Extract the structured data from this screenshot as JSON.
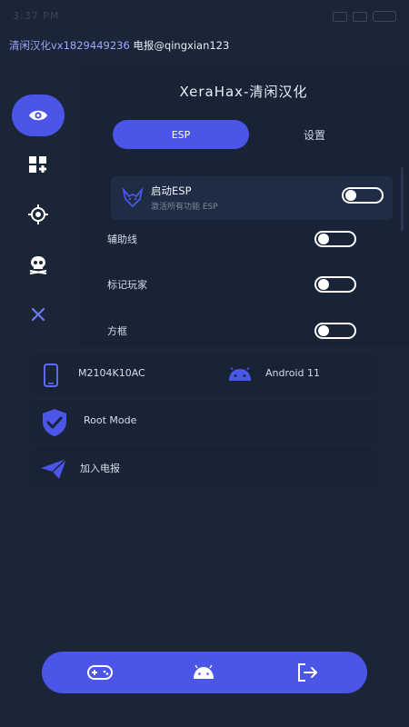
{
  "status_bar": {
    "time": "3:37 PM"
  },
  "marquee": {
    "prefix": "清闲汉化vx1829449236",
    "suffix": " 电报@qingxian123"
  },
  "panel": {
    "title": "XeraHax-清闲汉化",
    "tabs": [
      {
        "label": "ESP",
        "active": true
      },
      {
        "label": "设置",
        "active": false
      }
    ],
    "esp_toggle": {
      "title": "启动ESP",
      "subtitle": "激活所有功能 ESP",
      "enabled": false
    },
    "options": [
      {
        "label": "辅助线",
        "enabled": false
      },
      {
        "label": "标记玩家",
        "enabled": false
      },
      {
        "label": "方框",
        "enabled": false
      }
    ]
  },
  "device": {
    "model": "M2104K10AC",
    "os": "Android 11"
  },
  "root": {
    "label": "Root Mode"
  },
  "telegram": {
    "label": "加入电报"
  },
  "colors": {
    "accent": "#4b55e8",
    "background": "#1a2638",
    "panel": "#182336"
  },
  "nav": [
    "eye-icon",
    "widgets-icon",
    "target-icon",
    "skull-icon",
    "close-icon"
  ],
  "bottom_nav": [
    "gamepad-icon",
    "android-icon",
    "logout-icon"
  ]
}
